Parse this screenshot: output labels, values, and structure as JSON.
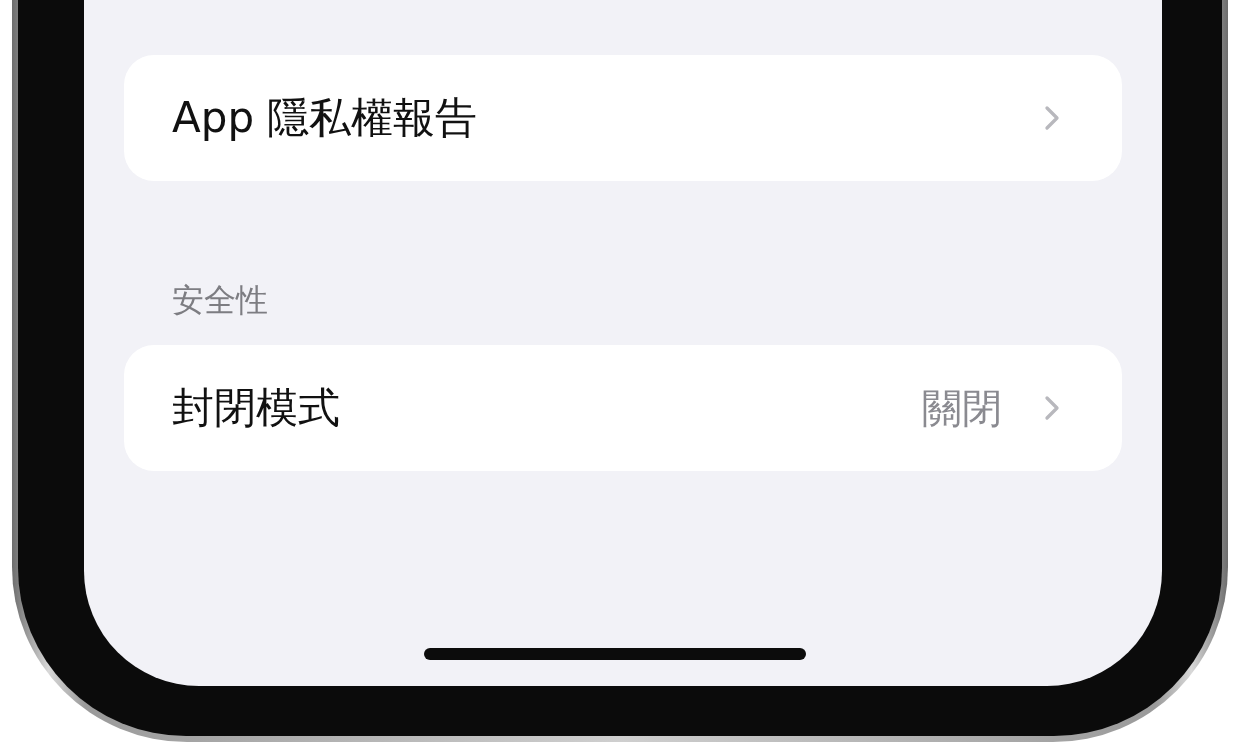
{
  "sections": [
    {
      "rows": [
        {
          "label": "App 隱私權報告"
        }
      ]
    },
    {
      "header": "安全性",
      "rows": [
        {
          "label": "封閉模式",
          "value": "關閉"
        }
      ]
    }
  ]
}
